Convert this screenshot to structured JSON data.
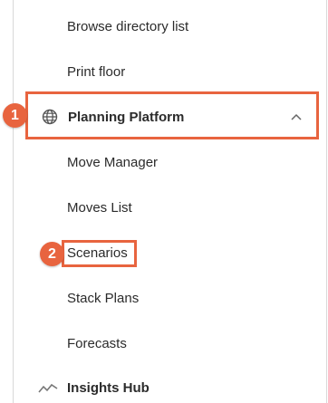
{
  "menu": {
    "items_before": [
      {
        "label": "Browse directory list"
      },
      {
        "label": "Print floor"
      }
    ],
    "section": {
      "icon": "globe-icon",
      "title": "Planning Platform",
      "toggle_icon": "chevron-up-icon",
      "expanded": true
    },
    "sub_items": [
      {
        "label": "Move Manager"
      },
      {
        "label": "Moves List"
      },
      {
        "label": "Scenarios"
      },
      {
        "label": "Stack Plans"
      },
      {
        "label": "Forecasts"
      }
    ],
    "next_section": {
      "icon": "trend-line-icon",
      "title": "Insights Hub"
    }
  },
  "annotations": {
    "step1": "1",
    "step2": "2",
    "highlight_color": "#e8643f"
  }
}
